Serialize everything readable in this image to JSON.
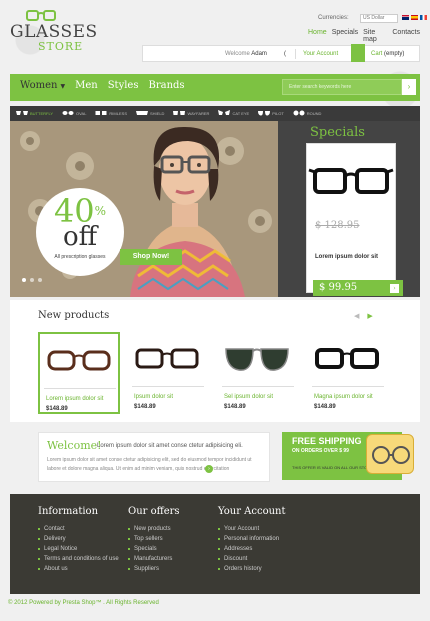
{
  "header": {
    "logo_name": "GLASSES",
    "logo_sub": "STORE",
    "currency_label": "Currencies:",
    "currency_value": "US Dollar",
    "top_links": [
      "Home",
      "Specials",
      "Site map",
      "Contacts"
    ],
    "welcome_text": "Welcome",
    "user_name": "Adam",
    "logout_label": "(",
    "account_label": "Your Account",
    "cart_label": "Cart",
    "cart_status": "(empty)"
  },
  "nav": {
    "items": [
      "Women",
      "Men",
      "Styles",
      "Brands"
    ],
    "search_placeholder": "Enter search keywords here",
    "search_button": "›"
  },
  "filters": [
    "BUTTERFLY",
    "OVAL",
    "RIMLESS",
    "SHIELD",
    "WAYFARER",
    "CAT EYE",
    "PILOT",
    "ROUND"
  ],
  "slider": {
    "pct": "40",
    "pct_sign": "%",
    "off": "off",
    "sub": "All prescription glasses",
    "cta": "Shop Now!",
    "dots": 3,
    "active_dot": 0
  },
  "specials": {
    "title": "Specials",
    "old_price": "$ 128.95",
    "product": "Lorem ipsum dolor sit",
    "price": "$ 99.95",
    "arrow": "›"
  },
  "new_products": {
    "title": "New products",
    "prev": "◀",
    "next": "▶",
    "items": [
      {
        "name": "Lorem ipsum dolor sit",
        "price": "$148.89"
      },
      {
        "name": "Ipsum dolor sit",
        "price": "$148.89"
      },
      {
        "name": "Sel ipsum dolor sit",
        "price": "$148.89"
      },
      {
        "name": "Magna ipsum dolor sit",
        "price": "$148.89"
      }
    ]
  },
  "welcome_box": {
    "title": "Welcome!",
    "lead": "Lorem ipsum dolor sit amet conse ctetur adipisicing eli.",
    "text": "Lorem ipsum dolor sit amet conse ctetur adipisicing elit, sed do eiusmod tempor incididunt ut labore et dolore magna aliqua. Ut enim ad minim veniam, quis nostrud exercitation",
    "more": "›"
  },
  "shipping": {
    "title": "FREE SHIPPING",
    "sub": "ON ORDERS OVER $ 99",
    "note": "THIS OFFER IS VALID ON ALL OUR STORE ITEMS"
  },
  "footer": {
    "columns": [
      {
        "title": "Information",
        "links": [
          "Contact",
          "Delivery",
          "Legal Notice",
          "Terms and conditions of use",
          "About us"
        ]
      },
      {
        "title": "Our offers",
        "links": [
          "New products",
          "Top sellers",
          "Specials",
          "Manufacturers",
          "Suppliers"
        ]
      },
      {
        "title": "Your Account",
        "links": [
          "Your Account",
          "Personal information",
          "Addresses",
          "Discount",
          "Orders history"
        ]
      }
    ],
    "copyright": "© 2012 Powered by Presta Shop™ . All Rights Reserved"
  },
  "colors": {
    "accent": "#7dc242",
    "dark": "#3b3a34",
    "text": "#333333"
  }
}
